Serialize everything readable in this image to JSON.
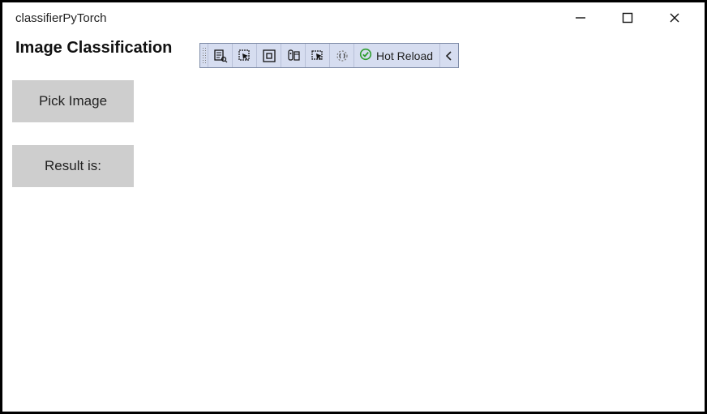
{
  "window": {
    "title": "classifierPyTorch"
  },
  "header": {
    "page_title": "Image Classification"
  },
  "debug_toolbar": {
    "hot_reload_label": "Hot Reload"
  },
  "content": {
    "pick_image_label": "Pick Image",
    "result_label": "Result is:"
  }
}
